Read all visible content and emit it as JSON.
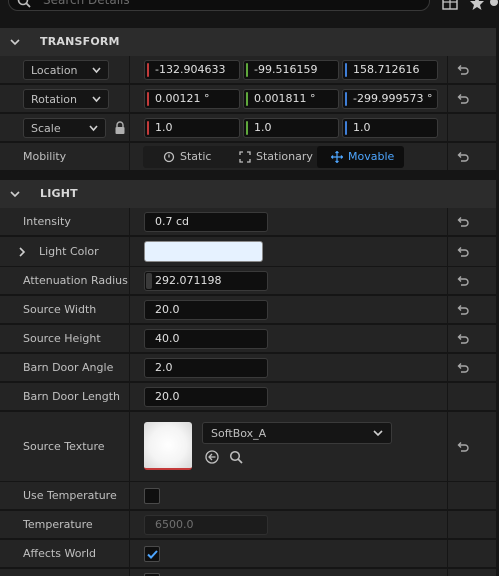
{
  "search": {
    "placeholder": "Search Details"
  },
  "transform": {
    "title": "TRANSFORM",
    "location": {
      "label": "Location",
      "x": "-132.904633",
      "y": "-99.516159",
      "z": "158.712616"
    },
    "rotation": {
      "label": "Rotation",
      "x": "0.00121 °",
      "y": "0.001811 °",
      "z": "-299.999573 °"
    },
    "scale": {
      "label": "Scale",
      "x": "1.0",
      "y": "1.0",
      "z": "1.0"
    },
    "mobility": {
      "label": "Mobility",
      "options": [
        "Static",
        "Stationary",
        "Movable"
      ],
      "selected": "Movable"
    }
  },
  "light": {
    "title": "LIGHT",
    "intensity": {
      "label": "Intensity",
      "value": "0.7 cd"
    },
    "light_color": {
      "label": "Light Color",
      "color": "#e6f2ff"
    },
    "attenuation_radius": {
      "label": "Attenuation Radius",
      "value": "292.071198"
    },
    "source_width": {
      "label": "Source Width",
      "value": "20.0"
    },
    "source_height": {
      "label": "Source Height",
      "value": "40.0"
    },
    "barn_door_angle": {
      "label": "Barn Door Angle",
      "value": "2.0"
    },
    "barn_door_length": {
      "label": "Barn Door Length",
      "value": "20.0"
    },
    "source_texture": {
      "label": "Source Texture",
      "asset": "SoftBox_A"
    },
    "use_temperature": {
      "label": "Use Temperature",
      "checked": false
    },
    "temperature": {
      "label": "Temperature",
      "value": "6500.0"
    },
    "affects_world": {
      "label": "Affects World",
      "checked": true
    }
  },
  "colors": {
    "x_axis": "#c23a3a",
    "y_axis": "#5fa83c",
    "z_axis": "#3f7fd8",
    "accent": "#4ea6ff"
  }
}
